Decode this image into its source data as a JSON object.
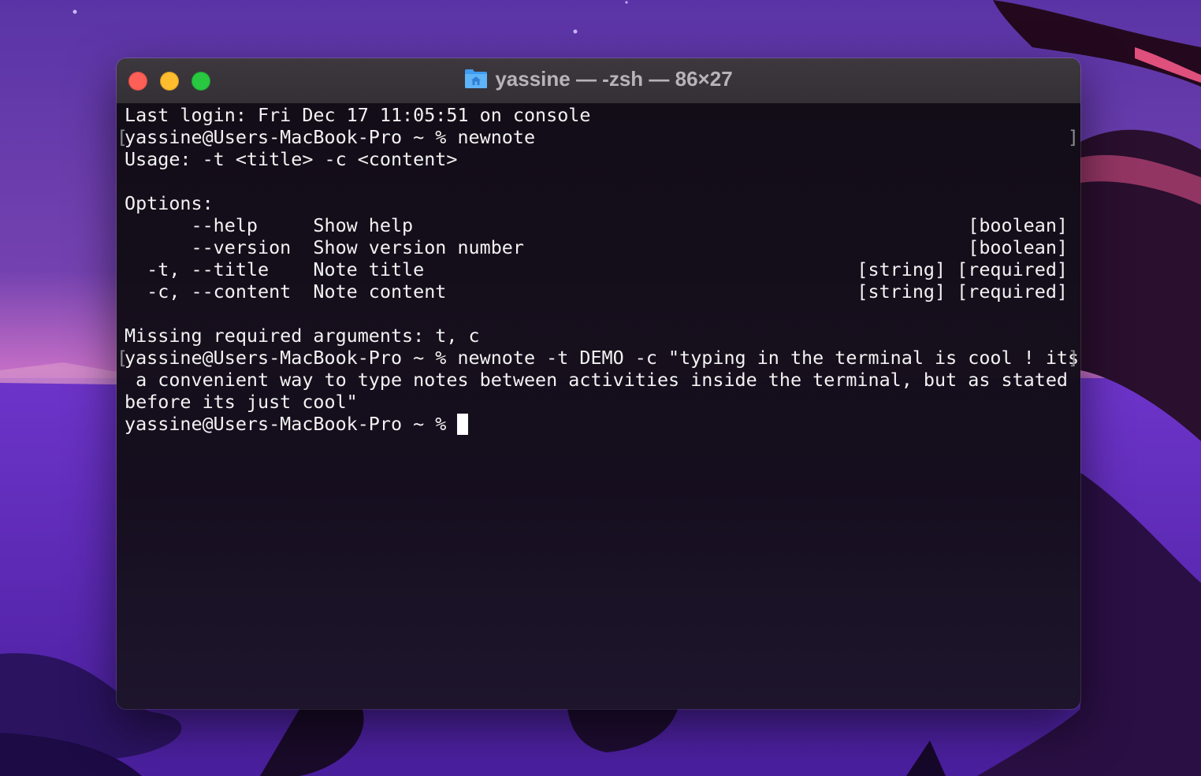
{
  "window": {
    "title": "yassine — -zsh — 86×27",
    "folder_icon": "home-folder-icon"
  },
  "colors": {
    "close": "#fe5f57",
    "minimize": "#febc2e",
    "zoom": "#28c840",
    "text": "#f2f2f2"
  },
  "terminal": {
    "lines": [
      "Last login: Fri Dec 17 11:05:51 on console",
      "yassine@Users-MacBook-Pro ~ % newnote",
      "Usage: -t <title> -c <content>",
      "",
      "Options:",
      "      --help     Show help                                                  [boolean]",
      "      --version  Show version number                                        [boolean]",
      "  -t, --title    Note title                                       [string] [required]",
      "  -c, --content  Note content                                     [string] [required]",
      "",
      "Missing required arguments: t, c",
      "yassine@Users-MacBook-Pro ~ % newnote -t DEMO -c \"typing in the terminal is cool ! its",
      " a convenient way to type notes between activities inside the terminal, but as stated",
      "before its just cool\""
    ],
    "prompt": "yassine@Users-MacBook-Pro ~ % "
  }
}
